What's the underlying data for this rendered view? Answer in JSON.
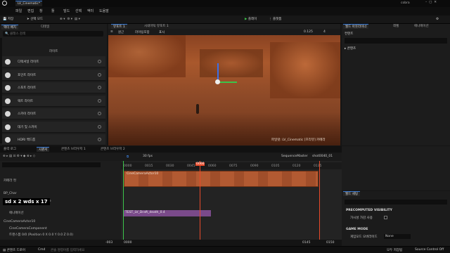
{
  "window": {
    "project_tab": "LV_Cinematic*",
    "project_name": "cobra"
  },
  "menu": [
    "파일",
    "편집",
    "창",
    "툴",
    "빌드",
    "선택",
    "액터",
    "도움말"
  ],
  "toolbar": {
    "save": "저장",
    "mode": "선택 모드",
    "platform": "플랫폼",
    "play": "플레이",
    "platforms": "플랫폼"
  },
  "left_panel": {
    "tabs": [
      "액터 배치",
      "디테일"
    ],
    "search_placeholder": "클래스 검색",
    "section": "라이트",
    "items": [
      {
        "label": "디렉셔널 라이트",
        "icon": "sun-icon"
      },
      {
        "label": "포인트 라이트",
        "icon": "bulb-icon"
      },
      {
        "label": "스포트 라이트",
        "icon": "spotlight-icon"
      },
      {
        "label": "렉트 라이트",
        "icon": "rect-light-icon"
      },
      {
        "label": "스카이 라이트",
        "icon": "sky-icon"
      },
      {
        "label": "대기 및 스카이",
        "icon": "atmosphere-icon"
      },
      {
        "label": "HDRI 백드롭",
        "icon": "cloud-icon"
      }
    ]
  },
  "viewport": {
    "tab": "뷰포트 1",
    "tab2": "시네마틱 뷰포트 1",
    "perspective": "원근",
    "lit": "라이팅포함",
    "show": "표시",
    "fov": "0.125",
    "speed": "4",
    "cam_label": "파일럿: LV_Cinematic [프리뷰] 카메라"
  },
  "right_panel": {
    "tabs": [
      "월드 아웃라이너",
      "레벨",
      "애니메이션"
    ],
    "content_label": "콘텐츠",
    "filter": "컨텐트",
    "search": "검색"
  },
  "bottom": {
    "tabs": [
      "출력 로그",
      "시퀀서",
      "콘텐츠 브라우저 1",
      "콘텐츠 브라우저 2"
    ],
    "fps": "30 fps",
    "seq_name": "SequenceMaster",
    "shot": "shot0040_01"
  },
  "sequencer": {
    "time_code": "0066",
    "ruler": [
      "0000",
      "0015",
      "0030",
      "0045",
      "0060",
      "0075",
      "0090",
      "0105",
      "0120",
      "0135"
    ],
    "tracks": [
      "카메라 컷",
      "BP_Char",
      "Character_01_Possessable",
      "애니메이션",
      "CineCameraActor10",
      "CineCameraComponent",
      "트랜스폼 0/0 (Position 0 X 0.0 Y 0.0 Z 0.0)"
    ],
    "anim_clip": "TEST_LV_Draft_death_0.4",
    "overlay": "sd x 2 wds x 17",
    "cam_cut": "CineCameraActor10",
    "bottom_in": "-003",
    "bottom_out": "0145",
    "bottom_in2": "0000",
    "bottom_out2": "0150"
  },
  "details": {
    "title": "월드 세팅",
    "search": "검색",
    "sections": [
      {
        "name": "PRECOMPUTED VISIBILITY",
        "rows": [
          {
            "label": "가시성 가감 사용",
            "value": ""
          }
        ]
      },
      {
        "name": "GAME MODE",
        "rows": [
          {
            "label": "게임모드 오버라이드",
            "value": "None"
          }
        ]
      }
    ]
  },
  "status": {
    "left": "콘텐츠 드로어",
    "cmd": "Cmd",
    "cmd_placeholder": "콘솔 명령어를 입력하세요",
    "right": "Source Control Off",
    "saved": "모두 저장됨"
  },
  "colors": {
    "accent": "#3a7bd5",
    "play": "#3cc44a",
    "playhead": "#e84a2a",
    "clip": "#b25a32",
    "anim": "#7a4a8a"
  }
}
